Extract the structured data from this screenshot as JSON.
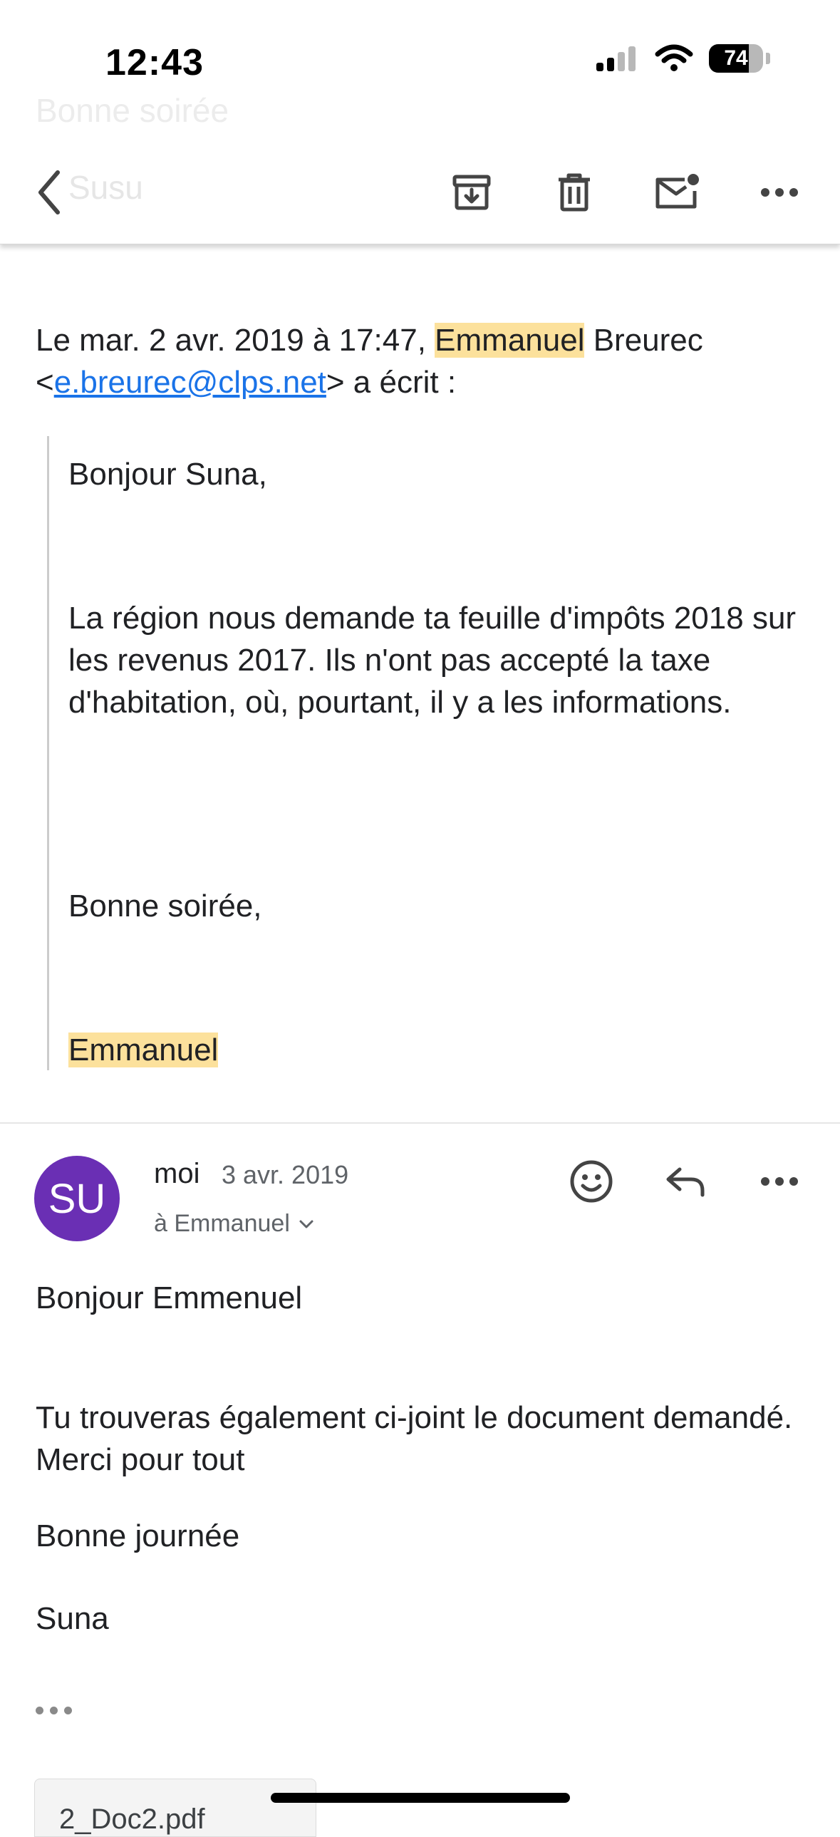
{
  "status_bar": {
    "time": "12:43",
    "battery": "74"
  },
  "ghost": {
    "title": "Bonne soirée",
    "subject": "Susu"
  },
  "toolbar": {
    "back_icon": "chevron-left-icon",
    "archive_icon": "archive-icon",
    "delete_icon": "trash-icon",
    "mark_unread_icon": "mail-unread-icon",
    "more_icon": "more-horizontal-icon"
  },
  "quoted": {
    "header_prefix": "Le mar. 2 avr. 2019 à 17:47, ",
    "header_name_hl": "Emmanuel",
    "header_name_rest": " Breurec",
    "lt": "<",
    "email": "e.breurec@clps.net",
    "header_suffix": "> a écrit :",
    "greeting": "Bonjour Suna,",
    "paragraph": "La région nous demande ta feuille d'impôts 2018 sur les revenus 2017. Ils n'ont  pas accepté la taxe d'habitation, où, pourtant, il y a les informations.",
    "closing": "Bonne soirée,",
    "signature": "Emmanuel"
  },
  "message": {
    "avatar_initials": "SU",
    "sender": "moi",
    "date": "3 avr. 2019",
    "recipient": "à Emmanuel",
    "greeting": "Bonjour Emmenuel",
    "paragraph": "Tu trouveras également ci-joint le document demandé. Merci pour tout",
    "closing": "Bonne journée",
    "signature": "Suna"
  },
  "attachment": {
    "name": "2_Doc2.pdf"
  },
  "colors": {
    "highlight": "#fce19c",
    "link": "#1a73e8",
    "avatar": "#6a2fb4"
  }
}
